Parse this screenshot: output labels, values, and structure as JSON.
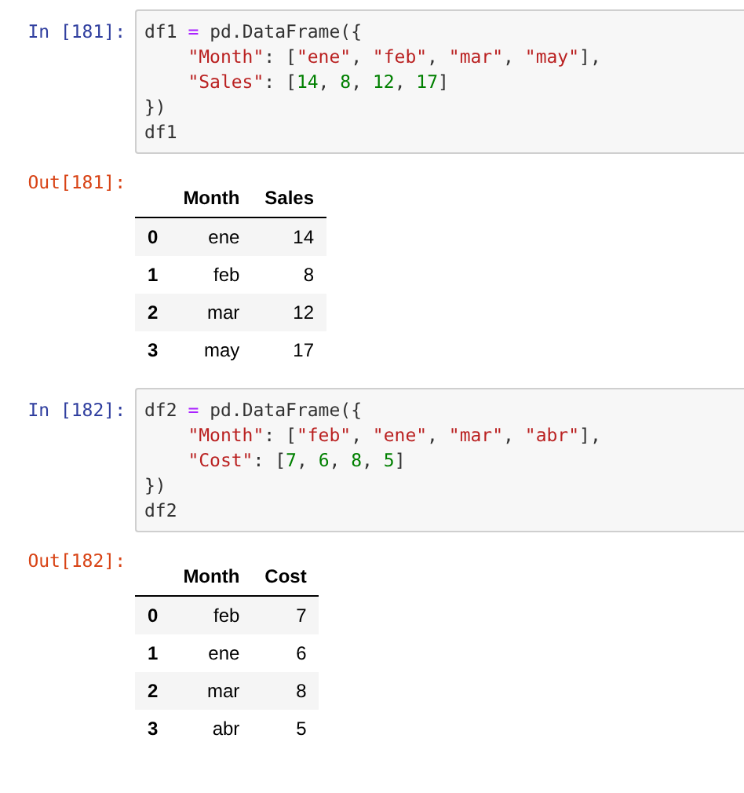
{
  "cells": [
    {
      "input_prompt": "In [181]:",
      "code": [
        {
          "indented": false,
          "tokens": [
            {
              "kind": "plain",
              "text": "df1 "
            },
            {
              "kind": "operator",
              "text": "="
            },
            {
              "kind": "plain",
              "text": " pd.DataFrame({"
            }
          ]
        },
        {
          "indented": true,
          "tokens": [
            {
              "kind": "string",
              "text": "\"Month\""
            },
            {
              "kind": "plain",
              "text": ": ["
            },
            {
              "kind": "string",
              "text": "\"ene\""
            },
            {
              "kind": "plain",
              "text": ", "
            },
            {
              "kind": "string",
              "text": "\"feb\""
            },
            {
              "kind": "plain",
              "text": ", "
            },
            {
              "kind": "string",
              "text": "\"mar\""
            },
            {
              "kind": "plain",
              "text": ", "
            },
            {
              "kind": "string",
              "text": "\"may\""
            },
            {
              "kind": "plain",
              "text": "],"
            }
          ]
        },
        {
          "indented": true,
          "tokens": [
            {
              "kind": "string",
              "text": "\"Sales\""
            },
            {
              "kind": "plain",
              "text": ": ["
            },
            {
              "kind": "number",
              "text": "14"
            },
            {
              "kind": "plain",
              "text": ", "
            },
            {
              "kind": "number",
              "text": "8"
            },
            {
              "kind": "plain",
              "text": ", "
            },
            {
              "kind": "number",
              "text": "12"
            },
            {
              "kind": "plain",
              "text": ", "
            },
            {
              "kind": "number",
              "text": "17"
            },
            {
              "kind": "plain",
              "text": "]"
            }
          ]
        },
        {
          "indented": false,
          "tokens": [
            {
              "kind": "plain",
              "text": "})"
            }
          ]
        },
        {
          "indented": false,
          "tokens": [
            {
              "kind": "plain",
              "text": "df1"
            }
          ]
        }
      ],
      "output_prompt": "Out[181]:",
      "table": {
        "columns": [
          "Month",
          "Sales"
        ],
        "rows": [
          {
            "index": "0",
            "cells": [
              "ene",
              "14"
            ]
          },
          {
            "index": "1",
            "cells": [
              "feb",
              "8"
            ]
          },
          {
            "index": "2",
            "cells": [
              "mar",
              "12"
            ]
          },
          {
            "index": "3",
            "cells": [
              "may",
              "17"
            ]
          }
        ]
      }
    },
    {
      "input_prompt": "In [182]:",
      "code": [
        {
          "indented": false,
          "tokens": [
            {
              "kind": "plain",
              "text": "df2 "
            },
            {
              "kind": "operator",
              "text": "="
            },
            {
              "kind": "plain",
              "text": " pd.DataFrame({"
            }
          ]
        },
        {
          "indented": true,
          "tokens": [
            {
              "kind": "string",
              "text": "\"Month\""
            },
            {
              "kind": "plain",
              "text": ": ["
            },
            {
              "kind": "string",
              "text": "\"feb\""
            },
            {
              "kind": "plain",
              "text": ", "
            },
            {
              "kind": "string",
              "text": "\"ene\""
            },
            {
              "kind": "plain",
              "text": ", "
            },
            {
              "kind": "string",
              "text": "\"mar\""
            },
            {
              "kind": "plain",
              "text": ", "
            },
            {
              "kind": "string",
              "text": "\"abr\""
            },
            {
              "kind": "plain",
              "text": "],"
            }
          ]
        },
        {
          "indented": true,
          "tokens": [
            {
              "kind": "string",
              "text": "\"Cost\""
            },
            {
              "kind": "plain",
              "text": ": ["
            },
            {
              "kind": "number",
              "text": "7"
            },
            {
              "kind": "plain",
              "text": ", "
            },
            {
              "kind": "number",
              "text": "6"
            },
            {
              "kind": "plain",
              "text": ", "
            },
            {
              "kind": "number",
              "text": "8"
            },
            {
              "kind": "plain",
              "text": ", "
            },
            {
              "kind": "number",
              "text": "5"
            },
            {
              "kind": "plain",
              "text": "]"
            }
          ]
        },
        {
          "indented": false,
          "tokens": [
            {
              "kind": "plain",
              "text": "})"
            }
          ]
        },
        {
          "indented": false,
          "tokens": [
            {
              "kind": "plain",
              "text": "df2"
            }
          ]
        }
      ],
      "output_prompt": "Out[182]:",
      "table": {
        "columns": [
          "Month",
          "Cost"
        ],
        "rows": [
          {
            "index": "0",
            "cells": [
              "feb",
              "7"
            ]
          },
          {
            "index": "1",
            "cells": [
              "ene",
              "6"
            ]
          },
          {
            "index": "2",
            "cells": [
              "mar",
              "8"
            ]
          },
          {
            "index": "3",
            "cells": [
              "abr",
              "5"
            ]
          }
        ]
      }
    }
  ]
}
